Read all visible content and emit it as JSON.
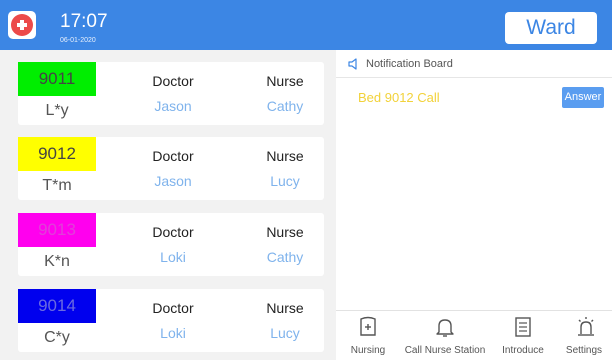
{
  "header": {
    "time": "17:07",
    "date": "06-01-2020",
    "ward_label": "Ward",
    "logo_icon": "medical-cross-icon"
  },
  "beds": [
    {
      "number": "9011",
      "patient": "L*y",
      "doctor_label": "Doctor",
      "doctor": "Jason",
      "nurse_label": "Nurse",
      "nurse": "Cathy",
      "color": "#00ee00"
    },
    {
      "number": "9012",
      "patient": "T*m",
      "doctor_label": "Doctor",
      "doctor": "Jason",
      "nurse_label": "Nurse",
      "nurse": "Lucy",
      "color": "#ffff00"
    },
    {
      "number": "9013",
      "patient": "K*n",
      "doctor_label": "Doctor",
      "doctor": "Loki",
      "nurse_label": "Nurse",
      "nurse": "Cathy",
      "color": "#ff00ee"
    },
    {
      "number": "9014",
      "patient": "C*y",
      "doctor_label": "Doctor",
      "doctor": "Loki",
      "nurse_label": "Nurse",
      "nurse": "Lucy",
      "color": "#0000ee"
    }
  ],
  "notification": {
    "title": "Notification Board",
    "icon": "speaker-icon",
    "messages": [
      {
        "text": "Bed 9012 Call",
        "action": "Answer"
      }
    ]
  },
  "nav": [
    {
      "label": "Nursing",
      "icon": "nursing-icon"
    },
    {
      "label": "Call Nurse Station",
      "icon": "bell-icon"
    },
    {
      "label": "Introduce",
      "icon": "document-icon"
    },
    {
      "label": "Settings",
      "icon": "alarm-icon"
    }
  ],
  "colors": {
    "accent": "#3c86e4",
    "call_text": "#f2d23a",
    "staff_name": "#7fb3ec"
  }
}
